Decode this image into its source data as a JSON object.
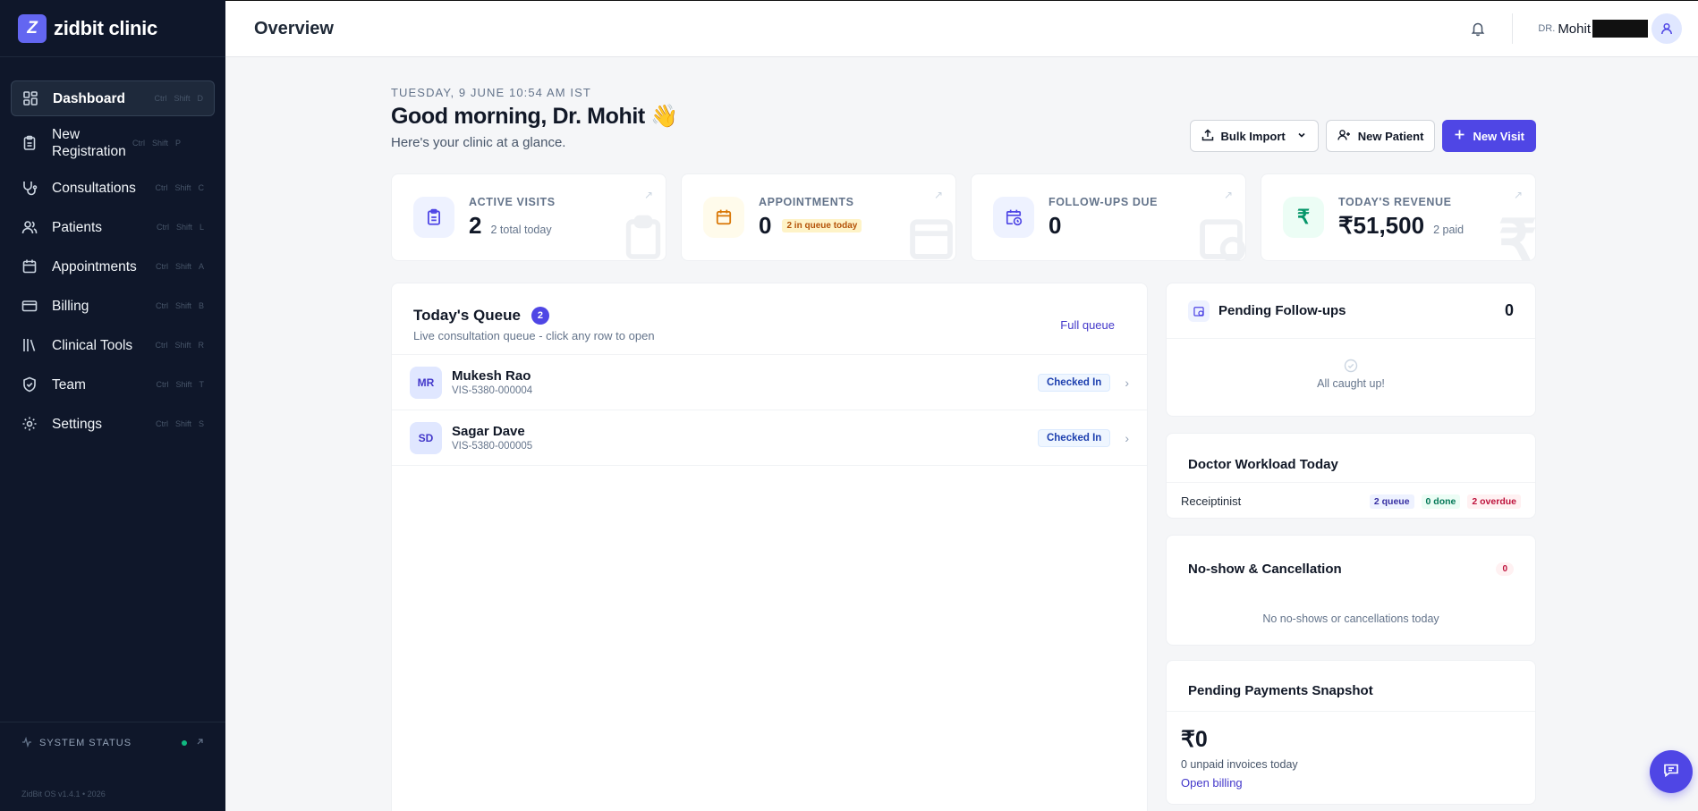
{
  "brand": {
    "logo_letter": "Z",
    "name": "zidbit clinic",
    "accent": "#6366f1"
  },
  "sidebar": {
    "items": [
      {
        "label": "Dashboard",
        "shortcut": [
          "Ctrl",
          "Shift",
          "D"
        ],
        "icon": "grid-icon",
        "active": true
      },
      {
        "label": "New Registration",
        "shortcut": [
          "Ctrl",
          "Shift",
          "P"
        ],
        "icon": "clipboard-icon"
      },
      {
        "label": "Consultations",
        "shortcut": [
          "Ctrl",
          "Shift",
          "C"
        ],
        "icon": "stethoscope-icon"
      },
      {
        "label": "Patients",
        "shortcut": [
          "Ctrl",
          "Shift",
          "L"
        ],
        "icon": "users-icon"
      },
      {
        "label": "Appointments",
        "shortcut": [
          "Ctrl",
          "Shift",
          "A"
        ],
        "icon": "calendar-icon"
      },
      {
        "label": "Billing",
        "shortcut": [
          "Ctrl",
          "Shift",
          "B"
        ],
        "icon": "credit-card-icon"
      },
      {
        "label": "Clinical Tools",
        "shortcut": [
          "Ctrl",
          "Shift",
          "R"
        ],
        "icon": "library-icon"
      },
      {
        "label": "Team",
        "shortcut": [
          "Ctrl",
          "Shift",
          "T"
        ],
        "icon": "shield-icon"
      },
      {
        "label": "Settings",
        "shortcut": [
          "Ctrl",
          "Shift",
          "S"
        ],
        "icon": "gear-icon"
      }
    ],
    "system_status": "SYSTEM STATUS",
    "version": "ZidBit OS v1.4.1 • 2026"
  },
  "header": {
    "title": "Overview",
    "user_prefix": "DR.",
    "user_name": "Mohit"
  },
  "main": {
    "date_line": "TUESDAY, 9 JUNE 10:54 AM IST",
    "greeting": "Good morning, Dr. Mohit 👋",
    "subtitle": "Here's your clinic at a glance.",
    "actions": {
      "bulk_import": "Bulk Import",
      "new_patient": "New Patient",
      "new_visit": "New Visit"
    },
    "stats": [
      {
        "label": "ACTIVE VISITS",
        "value": "2",
        "sub": "2 total today",
        "icon": "clipboard-icon",
        "color": "#4f46e5",
        "bg": "#eef2ff"
      },
      {
        "label": "APPOINTMENTS",
        "value": "0",
        "badge": "2 in queue today",
        "icon": "calendar-icon",
        "color": "#d97706",
        "bg": "#fffbeb"
      },
      {
        "label": "FOLLOW-UPS DUE",
        "value": "0",
        "icon": "calendar-clock-icon",
        "color": "#4f46e5",
        "bg": "#eef2ff"
      },
      {
        "label": "TODAY'S REVENUE",
        "value": "₹51,500",
        "sub": "2 paid",
        "icon": "rupee-icon",
        "color": "#059669",
        "bg": "#ecfdf5"
      }
    ],
    "queue": {
      "title": "Today's Queue",
      "count": "2",
      "subtitle": "Live consultation queue - click any row to open",
      "link": "Full queue",
      "rows": [
        {
          "initials": "MR",
          "name": "Mukesh Rao",
          "id": "VIS-5380-000004",
          "status": "Checked In"
        },
        {
          "initials": "SD",
          "name": "Sagar Dave",
          "id": "VIS-5380-000005",
          "status": "Checked In"
        }
      ]
    },
    "followups": {
      "title": "Pending Follow-ups",
      "count": "0",
      "empty": "All caught up!"
    },
    "workload": {
      "title": "Doctor Workload Today",
      "rows": [
        {
          "name": "Receiptinist",
          "queue": "2 queue",
          "done": "0 done",
          "overdue": "2 overdue"
        }
      ]
    },
    "noshow": {
      "title": "No-show & Cancellation",
      "count": "0",
      "empty": "No no-shows or cancellations today"
    },
    "payments": {
      "title": "Pending Payments Snapshot",
      "amount": "₹0",
      "sub": "0 unpaid invoices today",
      "link": "Open billing"
    }
  }
}
